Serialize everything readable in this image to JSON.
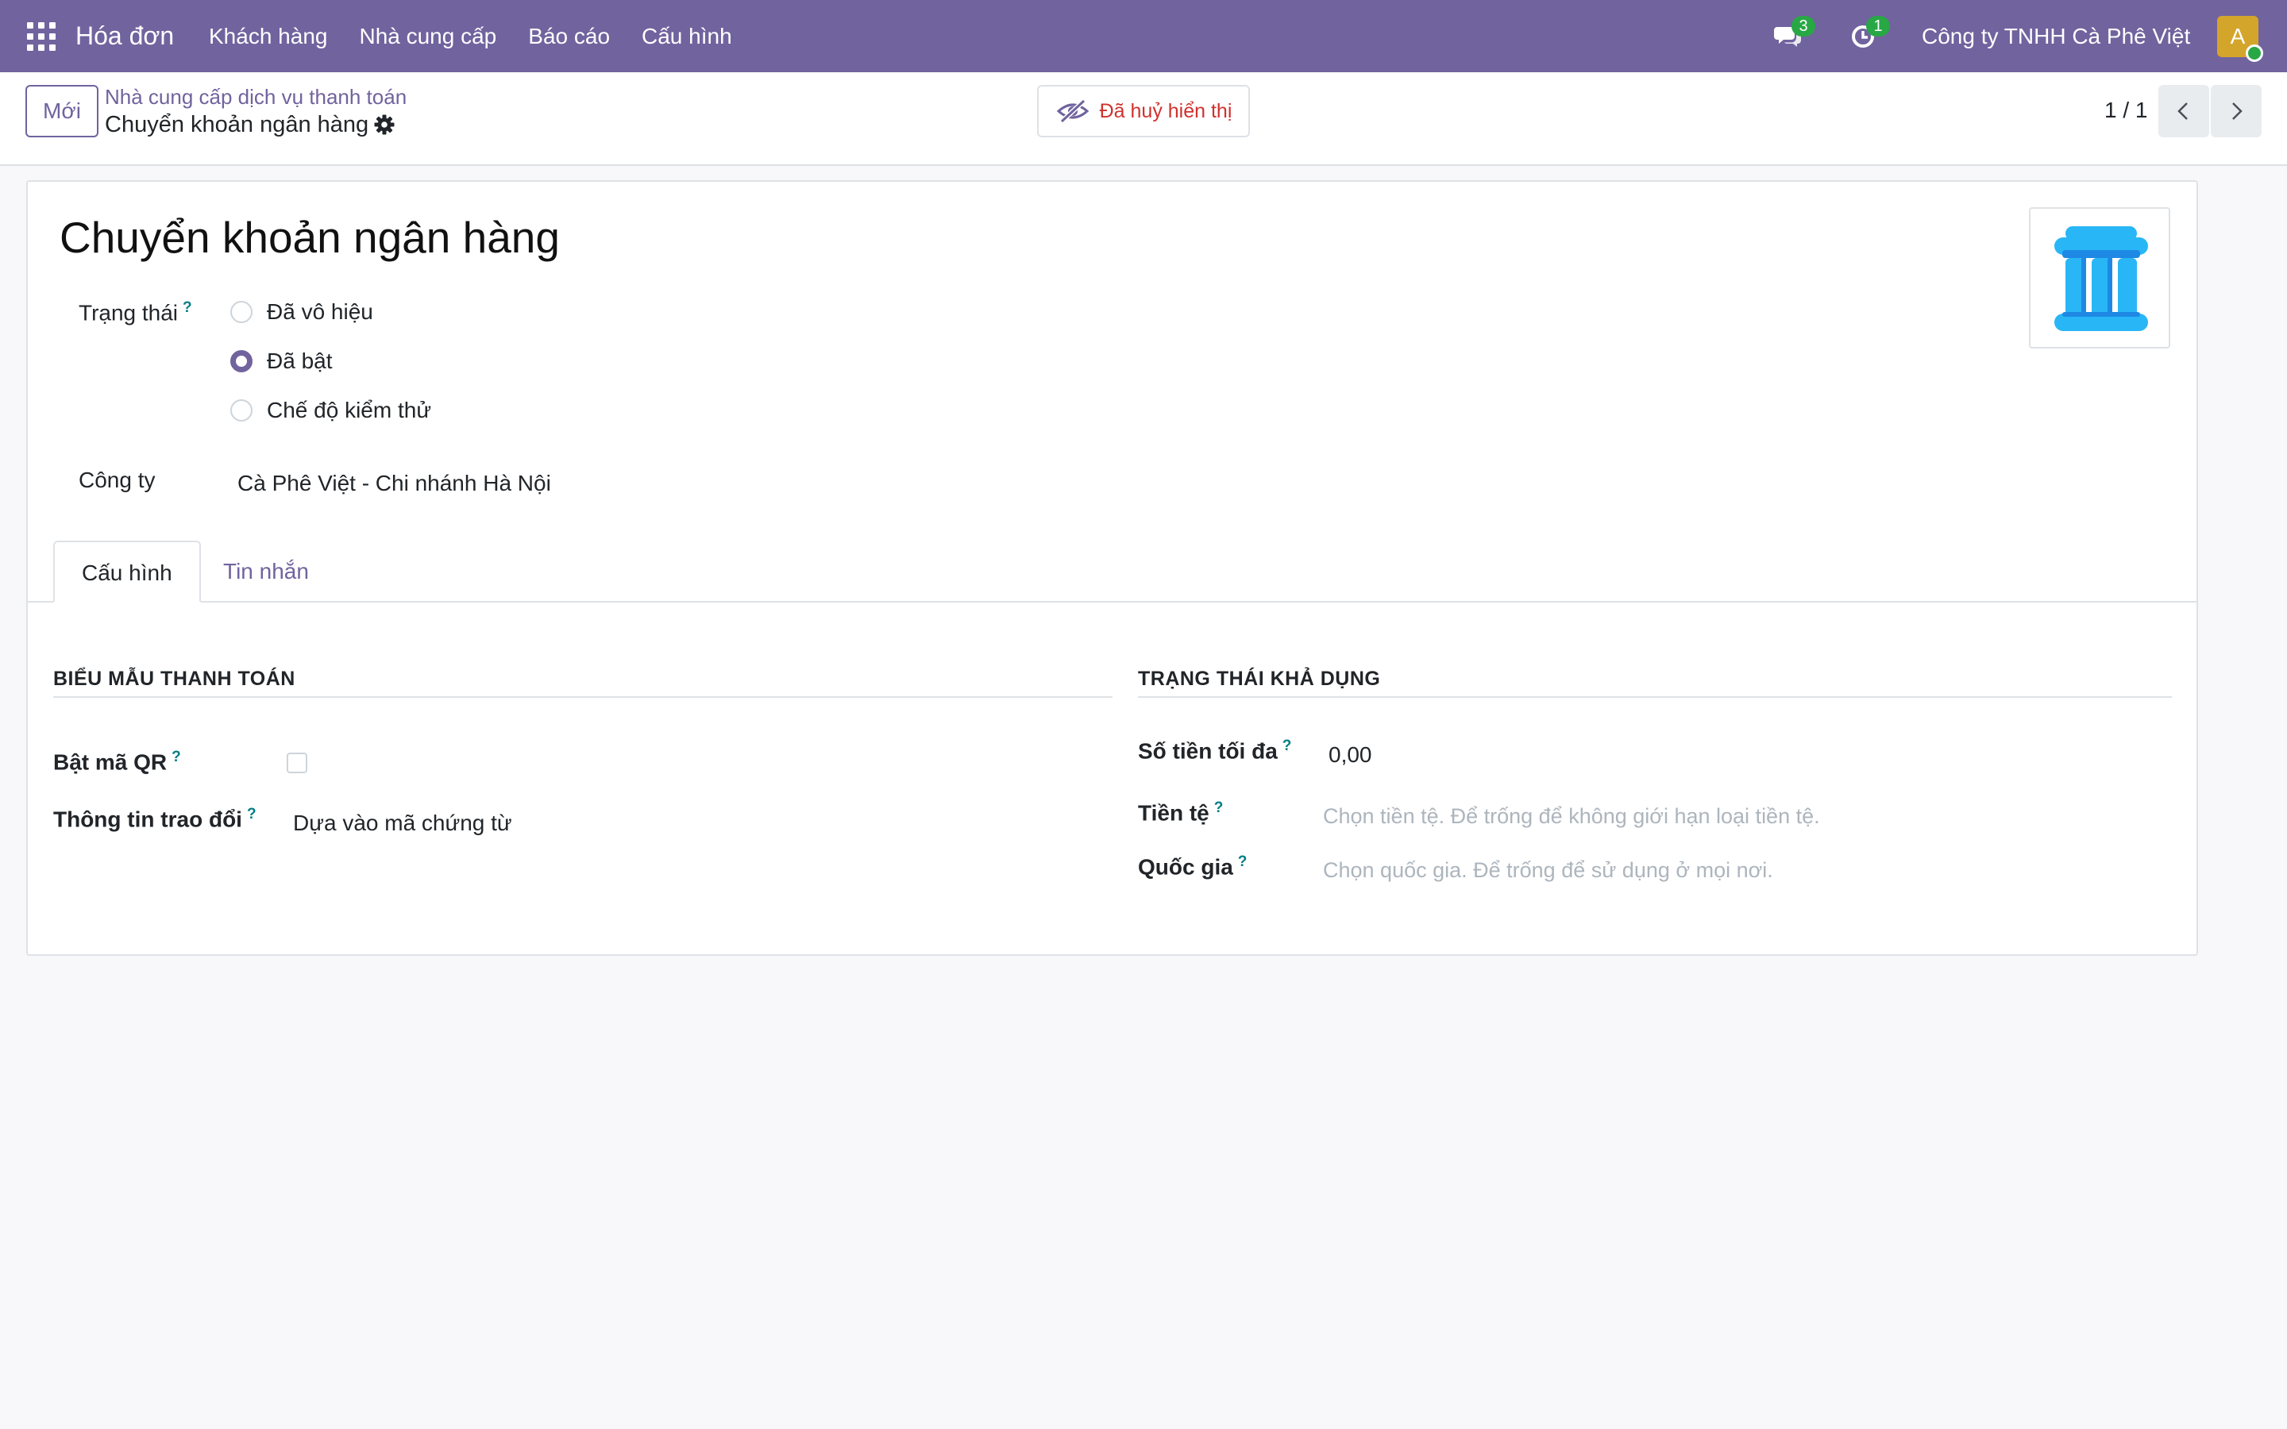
{
  "navbar": {
    "brand": "Hóa đơn",
    "menu": [
      "Khách hàng",
      "Nhà cung cấp",
      "Báo cáo",
      "Cấu hình"
    ],
    "messages_count": "3",
    "activities_count": "1",
    "company": "Công ty TNHH Cà Phê Việt",
    "avatar_initial": "A"
  },
  "control_panel": {
    "new_label": "Mới",
    "breadcrumb_parent": "Nhà cung cấp dịch vụ thanh toán",
    "breadcrumb_current": "Chuyển khoản ngân hàng",
    "unpublished_label": "Đã huỷ hiển thị",
    "pager": "1 / 1"
  },
  "form": {
    "title": "Chuyển khoản ngân hàng",
    "state_label": "Trạng thái",
    "state_options": [
      "Đã vô hiệu",
      "Đã bật",
      "Chế độ kiểm thử"
    ],
    "state_selected": "Đã bật",
    "company_label": "Công ty",
    "company_value": "Cà Phê Việt - Chi nhánh Hà Nội",
    "help_mark": "?",
    "tabs": [
      "Cấu hình",
      "Tin nhắn"
    ],
    "payment_form": {
      "title": "BIỂU MẪU THANH TOÁN",
      "qr_label": "Bật mã QR",
      "qr_checked": false,
      "communication_label": "Thông tin trao đổi",
      "communication_value": "Dựa vào mã chứng từ"
    },
    "availability": {
      "title": "TRẠNG THÁI KHẢ DỤNG",
      "max_amount_label": "Số tiền tối đa",
      "max_amount_value": "0,00",
      "currency_label": "Tiền tệ",
      "currency_placeholder": "Chọn tiền tệ. Để trống để không giới hạn loại tiền tệ.",
      "country_label": "Quốc gia",
      "country_placeholder": "Chọn quốc gia. Để trống để sử dụng ở mọi nơi."
    }
  },
  "colors": {
    "brand": "#71639e",
    "badge": "#28a745",
    "danger": "#d0312d",
    "help": "#017e84",
    "logo": "#29b6f6"
  }
}
